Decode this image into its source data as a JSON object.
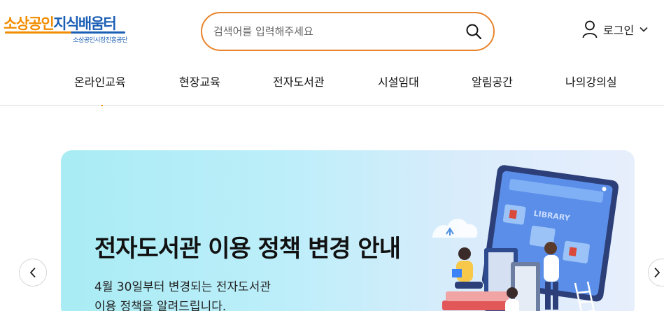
{
  "header": {
    "logo_main_a": "소상공인",
    "logo_main_b": "지식배움터",
    "logo_sub": "소상공인시장진흥공단",
    "search_placeholder": "검색어를 입력해주세요",
    "login_label": "로그인"
  },
  "nav": {
    "items": [
      "온라인교육",
      "현장교육",
      "전자도서관",
      "시설임대",
      "알림공간",
      "나의강의실"
    ]
  },
  "banner": {
    "title": "전자도서관 이용 정책 변경 안내",
    "desc_line1": "4월 30일부터 변경되는 전자도서관",
    "desc_line2": "이용 정책을 알려드립니다.",
    "art_label": "LIBRARY"
  },
  "colors": {
    "accent_orange": "#e8842c",
    "brand_blue": "#1b5fb5",
    "banner_bg": "#bdeefa"
  },
  "icons": [
    "search-icon",
    "user-icon",
    "chevron-down-icon",
    "chevron-left-icon",
    "chevron-right-icon"
  ]
}
